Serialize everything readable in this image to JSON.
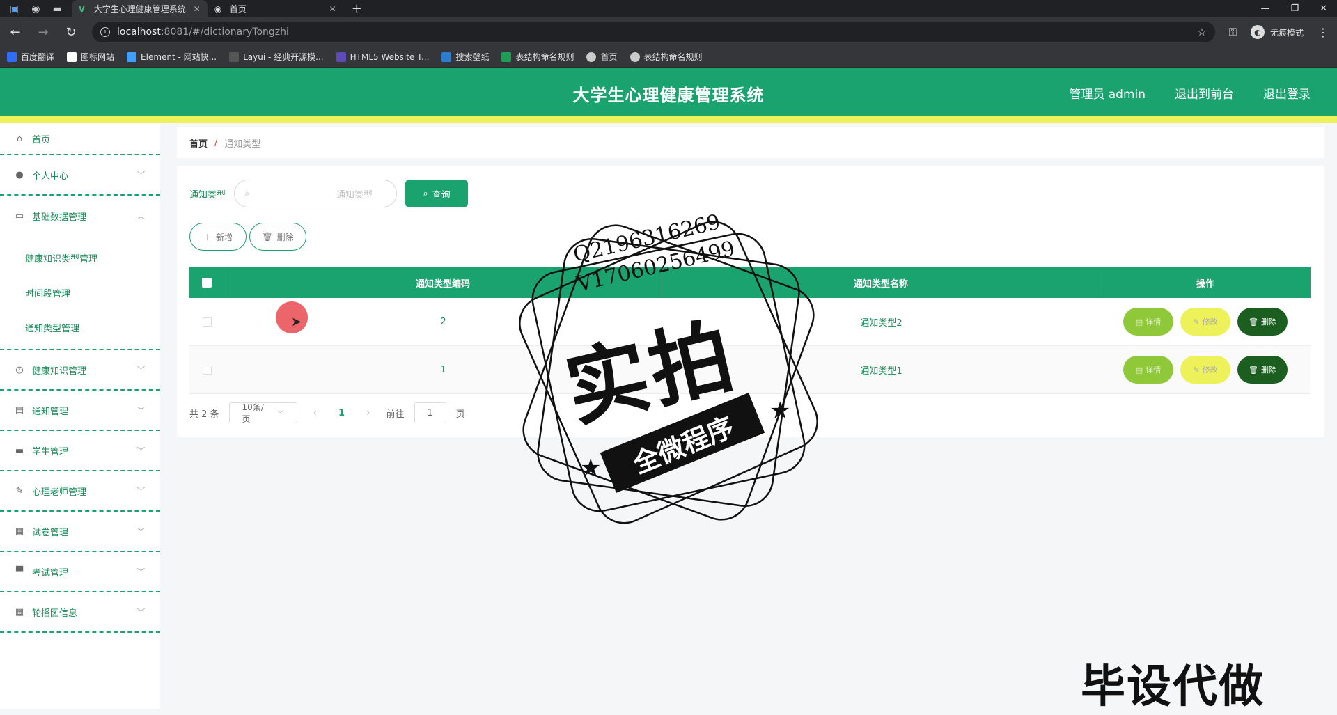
{
  "browser": {
    "tabs": [
      {
        "title": "大学生心理健康管理系统",
        "active": true
      },
      {
        "title": "首页",
        "active": false
      }
    ],
    "url_host": "localhost",
    "url_rest": ":8081/#/dictionaryTongzhi",
    "profile_label": "无痕模式",
    "bookmarks": [
      "百度翻译",
      "图标网站",
      "Element - 网站快...",
      "Layui - 经典开源模...",
      "HTML5 Website T...",
      "搜索壁纸",
      "表结构命名规则",
      "首页",
      "表结构命名规则"
    ]
  },
  "header": {
    "title": "大学生心理健康管理系统",
    "user": "管理员 admin",
    "front": "退出到前台",
    "logout": "退出登录"
  },
  "sidebar": {
    "items": [
      {
        "label": "首页",
        "icon": "home-icon"
      },
      {
        "label": "个人中心",
        "icon": "user-icon"
      },
      {
        "label": "基础数据管理",
        "icon": "chat-icon"
      },
      {
        "label": "健康知识管理",
        "icon": "clock-icon"
      },
      {
        "label": "通知管理",
        "icon": "bank-icon"
      },
      {
        "label": "学生管理",
        "icon": "message-icon"
      },
      {
        "label": "心理老师管理",
        "icon": "pen-icon"
      },
      {
        "label": "试卷管理",
        "icon": "clipboard-icon"
      },
      {
        "label": "考试管理",
        "icon": "monitor-icon"
      },
      {
        "label": "轮播图信息",
        "icon": "grid-icon"
      }
    ],
    "submenu": [
      "健康知识类型管理",
      "时间段管理",
      "通知类型管理"
    ]
  },
  "breadcrumb": {
    "home": "首页",
    "sep": "/",
    "current": "通知类型"
  },
  "search": {
    "label": "通知类型",
    "placeholder": "通知类型",
    "button": "查询"
  },
  "actions": {
    "add": "新增",
    "delete": "删除"
  },
  "table": {
    "headers": [
      "通知类型编码",
      "通知类型名称",
      "操作"
    ],
    "rows": [
      {
        "code": "2",
        "name": "通知类型2"
      },
      {
        "code": "1",
        "name": "通知类型1"
      }
    ],
    "buttons": {
      "detail": "详情",
      "edit": "修改",
      "delete": "删除"
    }
  },
  "pager": {
    "total": "共 2 条",
    "size": "10条/页",
    "current": "1",
    "goto_label": "前往",
    "goto_value": "1",
    "page_unit": "页"
  },
  "watermark": {
    "line1": "Q2196316269",
    "line2": "V17060256499",
    "big": "实拍",
    "ribbon": "全微程序",
    "corner": "毕设代做"
  }
}
